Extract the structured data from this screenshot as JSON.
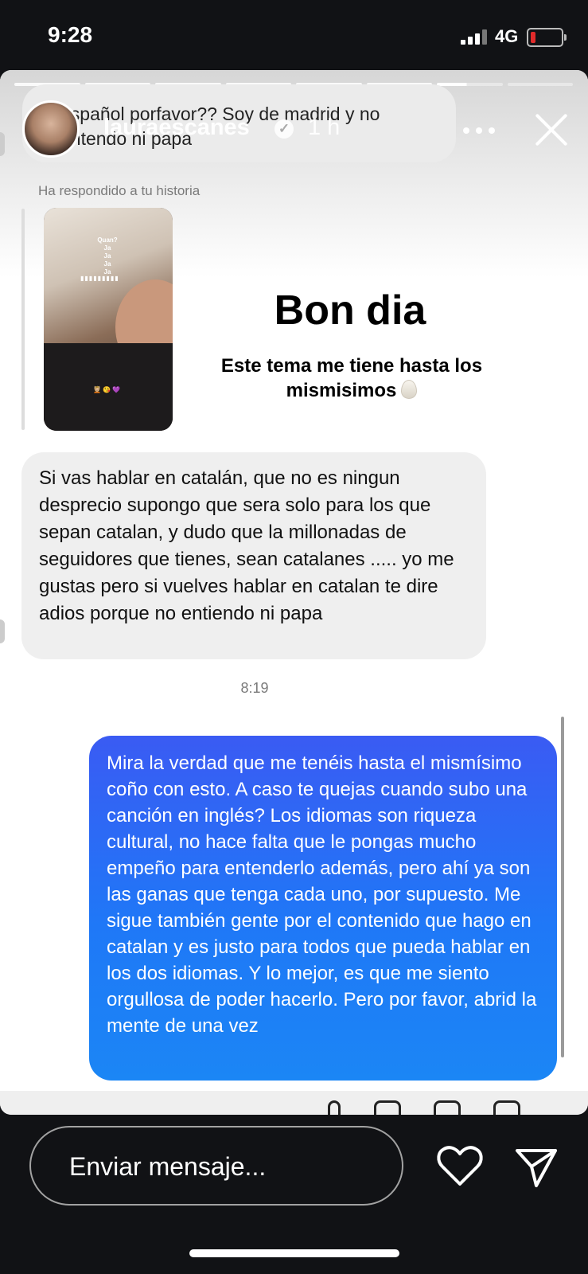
{
  "status_bar": {
    "time": "9:28",
    "network": "4G"
  },
  "story_header": {
    "username": "lauraescanes",
    "time_ago": "1 h",
    "quoted_text": "español porfavor?? Soy de madrid y no entendo ni papa"
  },
  "reply_context": {
    "label": "Ha respondido a tu historia",
    "thumb_text_top": "Quan?\nJa\nJa\nJa\nJa",
    "thumb_text_mid": "▮▮▮▮▮▮▮▮▮",
    "thumb_text_bottom": "💆🏼 😘 💜"
  },
  "story_overlay": {
    "title": "Bon dia",
    "subtitle": "Este tema me tiene hasta los mismisimos"
  },
  "messages": {
    "received": "Si vas hablar en catalán, que no es ningun desprecio supongo que sera solo para los que sepan catalan, y dudo que la millonadas de seguidores que tienes, sean catalanes ..... yo me gustas pero si vuelves hablar en catalan te dire adios porque no entiendo ni papa",
    "timestamp": "8:19",
    "sent": "Mira la verdad que me tenéis hasta el mismísimo coño con esto. A caso te quejas cuando subo una canción en inglés? Los idiomas son riqueza cultural, no hace falta que le pongas mucho empeño para entenderlo además, pero ahí ya son las ganas que tenga cada uno, por supuesto. Me sigue también gente por el contenido que hago en catalan y es justo para todos que pueda hablar en los dos idiomas. Y lo mejor, es que me siento orgullosa de poder hacerlo. Pero por favor, abrid la mente de una vez"
  },
  "composer": {
    "placeholder": "Enviar mensaje..."
  },
  "icons": {
    "heart": "heart-icon",
    "send": "send-icon",
    "close": "close-icon",
    "more": "more-icon",
    "verified": "verified-badge-icon"
  },
  "colors": {
    "sent_bubble": "#2a6cf5",
    "received_bubble": "#efefef",
    "battery_low": "#e02a2a"
  }
}
